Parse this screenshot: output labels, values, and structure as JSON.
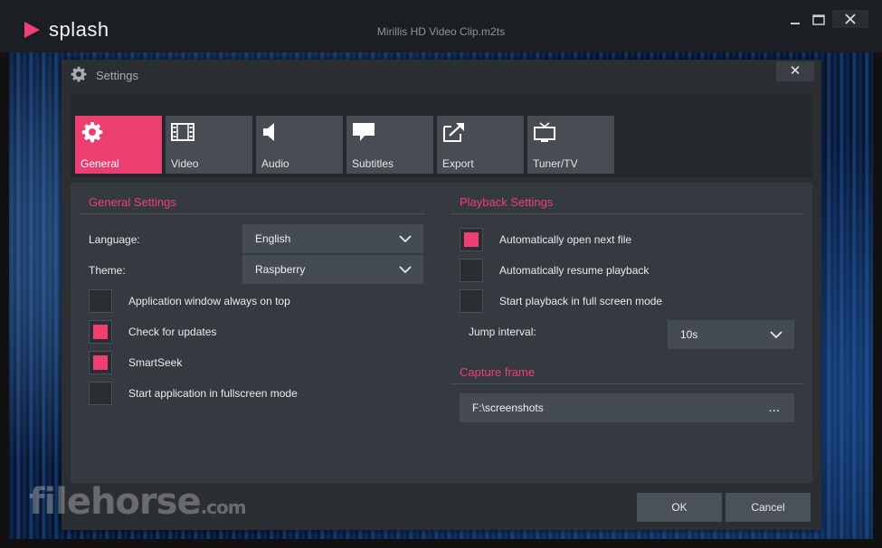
{
  "app": {
    "brand": "splash",
    "window_title": "Mirillis HD Video Clip.m2ts",
    "brand_color": "#ef3f73"
  },
  "dialog": {
    "title": "Settings",
    "close_glyph": "✕"
  },
  "tabs": [
    {
      "label": "General",
      "icon": "gear-icon",
      "active": true
    },
    {
      "label": "Video",
      "icon": "film-icon",
      "active": false
    },
    {
      "label": "Audio",
      "icon": "speaker-icon",
      "active": false
    },
    {
      "label": "Subtitles",
      "icon": "speech-bubble-icon",
      "active": false
    },
    {
      "label": "Export",
      "icon": "export-icon",
      "active": false
    },
    {
      "label": "Tuner/TV",
      "icon": "tv-icon",
      "active": false
    }
  ],
  "general": {
    "title": "General Settings",
    "language_label": "Language:",
    "language_value": "English",
    "theme_label": "Theme:",
    "theme_value": "Raspberry",
    "options": [
      {
        "label": "Application window always on top",
        "checked": false
      },
      {
        "label": "Check for updates",
        "checked": true
      },
      {
        "label": "SmartSeek",
        "checked": true
      },
      {
        "label": "Start application in fullscreen mode",
        "checked": false
      }
    ]
  },
  "playback": {
    "title": "Playback Settings",
    "options": [
      {
        "label": "Automatically open next file",
        "checked": true
      },
      {
        "label": "Automatically resume playback",
        "checked": false
      },
      {
        "label": "Start playback in full screen mode",
        "checked": false
      }
    ],
    "jump_label": "Jump interval:",
    "jump_value": "10s"
  },
  "capture": {
    "title": "Capture frame",
    "path": "F:\\screenshots",
    "browse": "..."
  },
  "footer": {
    "ok": "OK",
    "cancel": "Cancel"
  },
  "watermark": {
    "main": "filehorse",
    "suffix": ".com"
  }
}
